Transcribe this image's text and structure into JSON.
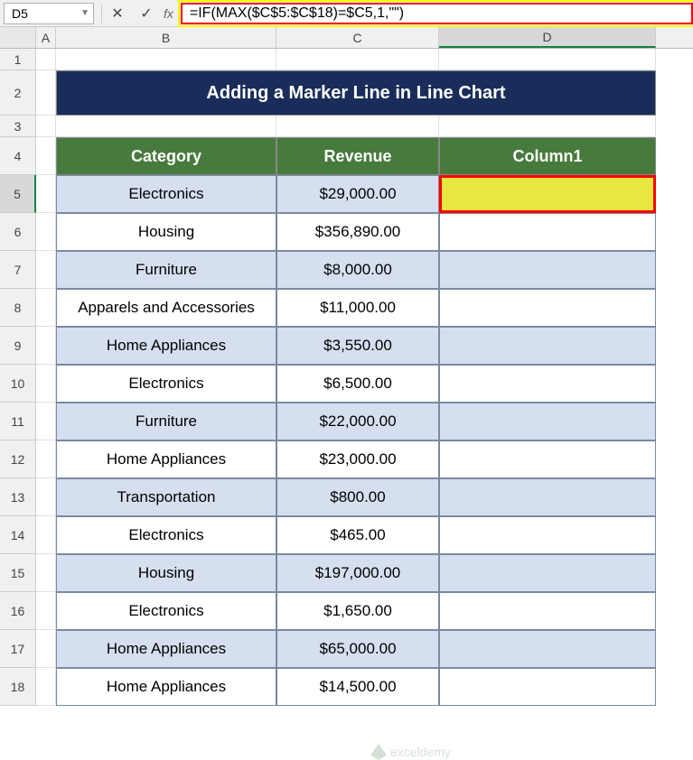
{
  "nameBox": "D5",
  "formula": "=IF(MAX($C$5:$C$18)=$C5,1,\"\")",
  "fxLabel": "fx",
  "columns": [
    "A",
    "B",
    "C",
    "D"
  ],
  "rowNums": [
    "1",
    "2",
    "3",
    "4",
    "5",
    "6",
    "7",
    "8",
    "9",
    "10",
    "11",
    "12",
    "13",
    "14",
    "15",
    "16",
    "17",
    "18"
  ],
  "title": "Adding a Marker Line in Line Chart",
  "headers": {
    "b": "Category",
    "c": "Revenue",
    "d": "Column1"
  },
  "rows": [
    {
      "cat": "Electronics",
      "rev": "$29,000.00",
      "col1": ""
    },
    {
      "cat": "Housing",
      "rev": "$356,890.00",
      "col1": ""
    },
    {
      "cat": "Furniture",
      "rev": "$8,000.00",
      "col1": ""
    },
    {
      "cat": "Apparels and Accessories",
      "rev": "$11,000.00",
      "col1": ""
    },
    {
      "cat": "Home Appliances",
      "rev": "$3,550.00",
      "col1": ""
    },
    {
      "cat": "Electronics",
      "rev": "$6,500.00",
      "col1": ""
    },
    {
      "cat": "Furniture",
      "rev": "$22,000.00",
      "col1": ""
    },
    {
      "cat": "Home Appliances",
      "rev": "$23,000.00",
      "col1": ""
    },
    {
      "cat": "Transportation",
      "rev": "$800.00",
      "col1": ""
    },
    {
      "cat": "Electronics",
      "rev": "$465.00",
      "col1": ""
    },
    {
      "cat": "Housing",
      "rev": "$197,000.00",
      "col1": ""
    },
    {
      "cat": "Electronics",
      "rev": "$1,650.00",
      "col1": ""
    },
    {
      "cat": "Home Appliances",
      "rev": "$65,000.00",
      "col1": ""
    },
    {
      "cat": "Home Appliances",
      "rev": "$14,500.00",
      "col1": ""
    }
  ],
  "watermark": "exceldemy"
}
